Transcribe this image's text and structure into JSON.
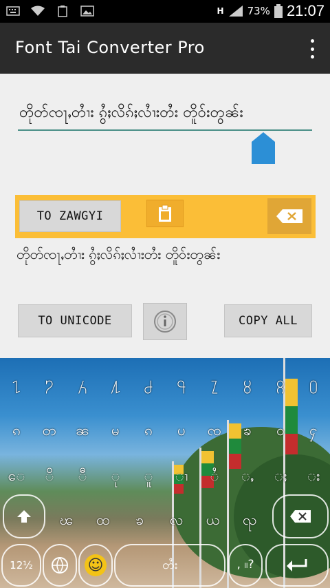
{
  "status_bar": {
    "icons": [
      "keyboard-icon",
      "wifi-icon",
      "recycle-icon",
      "image-icon"
    ],
    "network": "H",
    "battery_percent": "73%",
    "time": "21:07"
  },
  "app_bar": {
    "title": "Font Tai Converter Pro",
    "menu_icon": "overflow-menu-icon"
  },
  "input": {
    "value": "တိုတ်ၸႃႇတၢႆး ၵွႆႈလိၵ်ႈလၢႆးတႆး တိူဝ်းတွၼ်း"
  },
  "actions": {
    "to_zawgyi": "TO ZAWGYI",
    "to_unicode": "TO UNICODE",
    "copy_all": "COPY ALL",
    "accent_color": "#fbbe37"
  },
  "output": {
    "value": "တိုတ်ၸႃႇတၢႆး ၵွႆႈလိၵ်ႈလၢႆးတႆး တိူဝ်းတွၼ်း"
  },
  "keyboard": {
    "row1": [
      "႑",
      "႒",
      "႓",
      "႔",
      "႕",
      "႖",
      "႗",
      "႘",
      "႙",
      "႐"
    ],
    "row2": [
      "ၵ",
      "တ",
      "ၼ",
      "မ",
      "ၵ",
      "ပ",
      "ၸ",
      "ၶ",
      "ဝ",
      "ႁ"
    ],
    "row3": [
      "ေ",
      "ိ",
      "ီ",
      "ု",
      "ူ",
      "ၢ",
      "ႆ",
      "ႇ",
      "ႈ",
      "း"
    ],
    "row4": [
      "ၽ",
      "ထ",
      "ၶ",
      "လ",
      "ယ",
      "ၺ"
    ],
    "bottom": {
      "num_key": "12½",
      "globe_key": "globe-icon",
      "emoji_key": "☺",
      "space_label": "တႆး",
      "punct_key": ", ။?",
      "enter_key": "enter-icon",
      "shift_key": "shift-icon",
      "backspace_key": "backspace-icon"
    }
  }
}
